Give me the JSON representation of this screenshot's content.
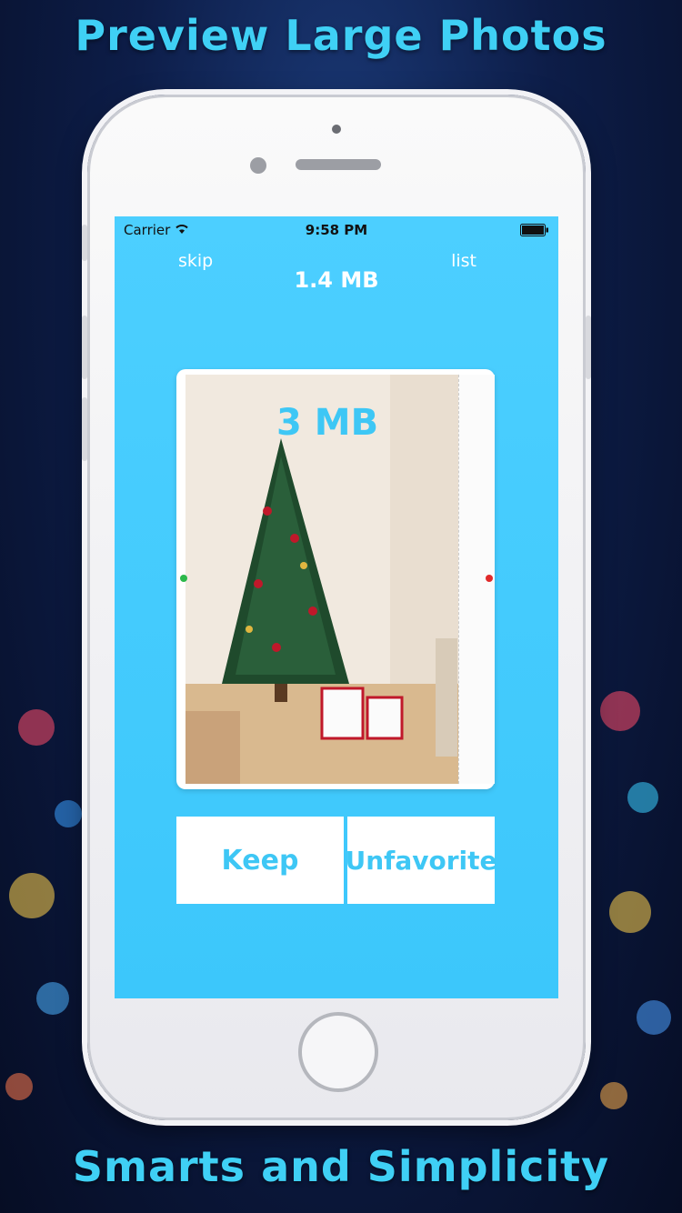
{
  "promo": {
    "title_top": "Preview Large Photos",
    "title_bottom": "Smarts and Simplicity"
  },
  "status_bar": {
    "carrier": "Carrier",
    "time": "9:58 PM"
  },
  "nav": {
    "skip_label": "skip",
    "list_label": "list",
    "file_size": "1.4 MB"
  },
  "photo": {
    "overlay_size": "3 MB"
  },
  "actions": {
    "keep_label": "Keep",
    "unfavorite_label": "Unfavorite"
  },
  "colors": {
    "accent": "#3ec7f5",
    "screen_bg": "#47cdfd",
    "promo_text": "#3fd0f5"
  }
}
